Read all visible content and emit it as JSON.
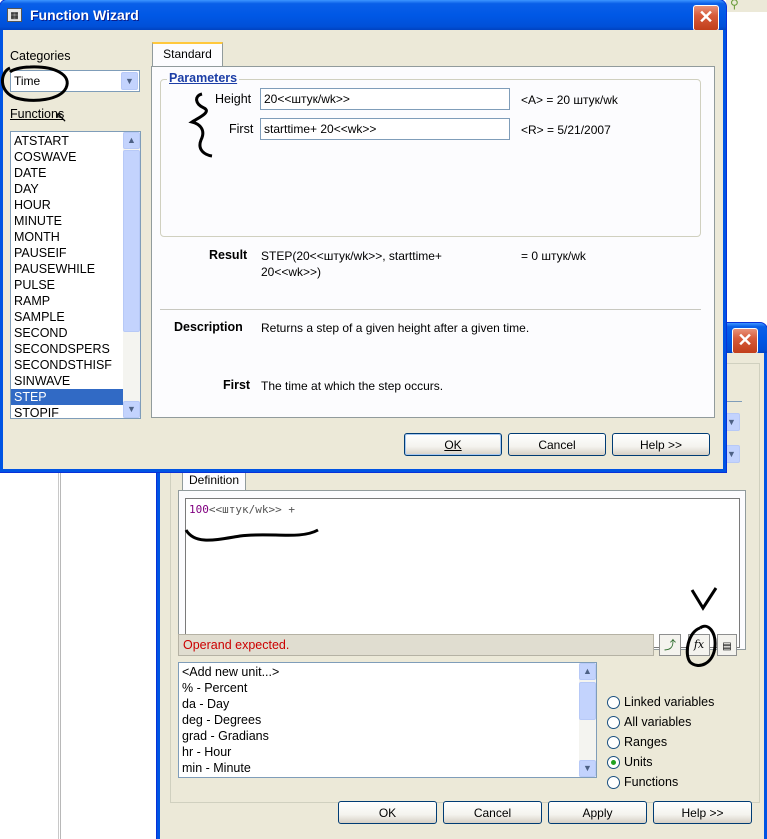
{
  "wizard": {
    "title": "Function Wizard",
    "close_glyph": "✕",
    "categories_label": "Categories",
    "category_value": "Time",
    "functions_label": "Functions",
    "functions": [
      "ATSTART",
      "COSWAVE",
      "DATE",
      "DAY",
      "HOUR",
      "MINUTE",
      "MONTH",
      "PAUSEIF",
      "PAUSEWHILE",
      "PULSE",
      "RAMP",
      "SAMPLE",
      "SECOND",
      "SECONDSPERS",
      "SECONDSTHISF",
      "SINWAVE",
      "STEP",
      "STOPIF"
    ],
    "selected_function": "STEP",
    "tab_standard": "Standard",
    "parameters_label": "Parameters",
    "height_label": "Height",
    "height_value": "20<<штук/wk>>",
    "height_eval": "<A> = 20 штук/wk",
    "first_label": "First",
    "first_value": "starttime+ 20<<wk>>",
    "first_eval": "<R> = 5/21/2007",
    "result_label": "Result",
    "result_line1": "STEP(20<<штук/wk>>, starttime+",
    "result_line2": "20<<wk>>)",
    "result_eval": "= 0 штук/wk",
    "description_label": "Description",
    "description_text": "Returns a step of a given height after a given time.",
    "first_desc_label": "First",
    "first_desc_text": "The time at which the step occurs.",
    "ok_label": "OK",
    "cancel_label": "Cancel",
    "help_label": "Help >>"
  },
  "editor": {
    "close_glyph": "✕",
    "tab_definition": "Definition",
    "definition_number": "100",
    "definition_unit": "<<штук/wk>>",
    "definition_op": " +",
    "error_message": "Operand expected.",
    "units_list": [
      "<Add new unit...>",
      "% - Percent",
      "da - Day",
      "deg - Degrees",
      "grad - Gradians",
      "hr - Hour",
      "min - Minute"
    ],
    "radio_options": [
      {
        "label": "Linked variables",
        "checked": false
      },
      {
        "label": "All variables",
        "checked": false
      },
      {
        "label": "Ranges",
        "checked": false
      },
      {
        "label": "Units",
        "checked": true
      },
      {
        "label": "Functions",
        "checked": false
      }
    ],
    "ok_label": "OK",
    "cancel_label": "Cancel",
    "apply_label": "Apply",
    "help_label": "Help >>"
  },
  "colors": {
    "xp_title": "#0054e3",
    "selection": "#316ac5",
    "error_text": "#cc0000",
    "param_header": "#1c3ea6",
    "code_purple": "#800080"
  }
}
